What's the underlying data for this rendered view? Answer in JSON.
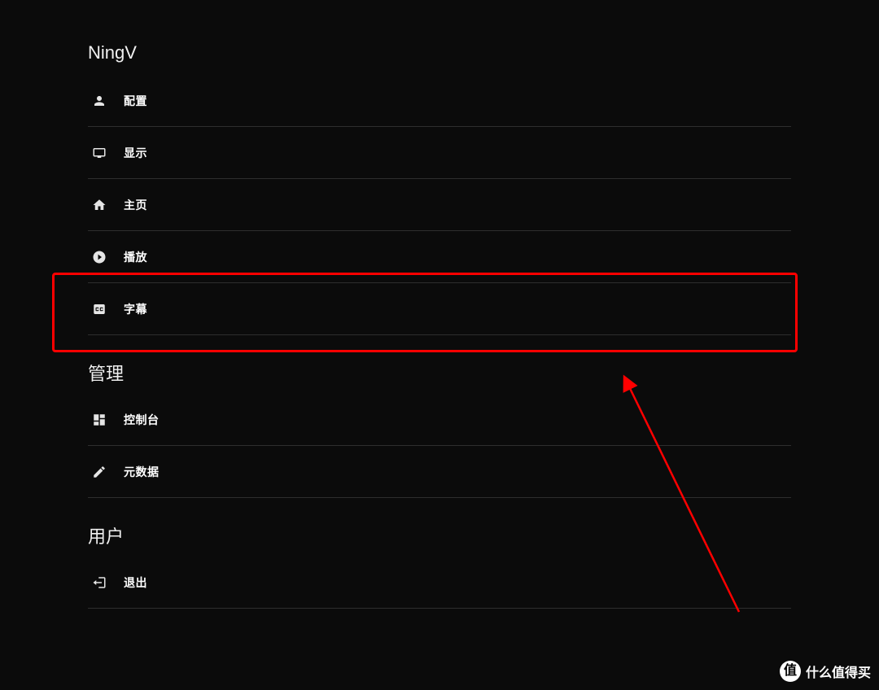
{
  "section1": {
    "title": "NingV",
    "items": [
      {
        "label": "配置"
      },
      {
        "label": "显示"
      },
      {
        "label": "主页"
      },
      {
        "label": "播放"
      },
      {
        "label": "字幕"
      }
    ]
  },
  "section2": {
    "title": "管理",
    "items": [
      {
        "label": "控制台"
      },
      {
        "label": "元数据"
      }
    ]
  },
  "section3": {
    "title": "用户",
    "items": [
      {
        "label": "退出"
      }
    ]
  },
  "watermark": {
    "badge": "值",
    "text": "什么值得买"
  }
}
